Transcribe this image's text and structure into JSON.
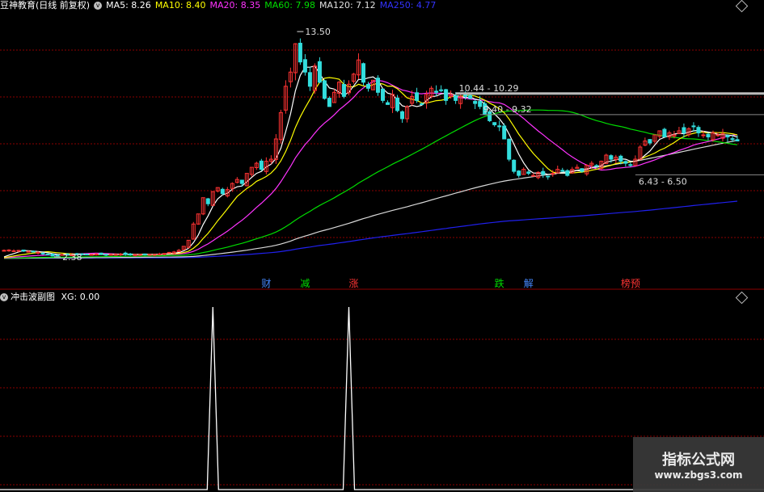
{
  "header": {
    "title": "豆神教育(日线 前复权)",
    "ma_labels": [
      {
        "text": "MA5: 8.26",
        "color": "#ffffff"
      },
      {
        "text": "MA10: 8.40",
        "color": "#ffff00"
      },
      {
        "text": "MA20: 8.35",
        "color": "#ff33ff"
      },
      {
        "text": "MA60: 7.98",
        "color": "#00dd00"
      },
      {
        "text": "MA120: 7.12",
        "color": "#e0e0e0"
      },
      {
        "text": "MA250: 4.77",
        "color": "#3333ff"
      }
    ]
  },
  "sub_header": {
    "title": "冲击波副图",
    "value": "XG: 0.00"
  },
  "watermark": {
    "line1": "指标公式网",
    "line2": "www.zbgs3.com"
  },
  "colors": {
    "up": "#ff3333",
    "down": "#33dddd",
    "grid": "#8b0000",
    "ma5": "#ffffff",
    "ma10": "#ffff00",
    "ma20": "#ff33ff",
    "ma60": "#00dd00",
    "ma120": "#d8d8d8",
    "ma250": "#2020ee"
  },
  "chart_data": {
    "type": "candlestick",
    "price_range": [
      1.5,
      14.5
    ],
    "high_low_marks": [
      {
        "text": "13.50",
        "price": 13.5,
        "bar": 60
      },
      {
        "text": "2.38",
        "price": 2.38,
        "bar": 10
      }
    ],
    "range_labels": [
      {
        "text": "10.44 - 10.29",
        "price": 10.44,
        "from_bar": 93
      },
      {
        "text": "9.40 - 9.32",
        "price": 9.4,
        "from_bar": 98
      },
      {
        "text": "6.43 - 6.50",
        "price": 6.43,
        "from_bar": 130
      }
    ],
    "event_tags": [
      {
        "text": "财",
        "bar": 54,
        "color": "#4488ff"
      },
      {
        "text": "减",
        "bar": 62,
        "color": "#00dd00"
      },
      {
        "text": "涨",
        "bar": 72,
        "color": "#ff3333"
      },
      {
        "text": "跌",
        "bar": 102,
        "color": "#00dd00"
      },
      {
        "text": "解",
        "bar": 108,
        "color": "#4488ff"
      },
      {
        "text": "榜预",
        "bar": 129,
        "color": "#ff3333"
      }
    ],
    "closes": [
      2.7,
      2.72,
      2.68,
      2.7,
      2.66,
      2.65,
      2.62,
      2.6,
      2.55,
      2.5,
      2.42,
      2.45,
      2.5,
      2.48,
      2.5,
      2.52,
      2.5,
      2.48,
      2.5,
      2.52,
      2.5,
      2.48,
      2.5,
      2.5,
      2.52,
      2.5,
      2.48,
      2.5,
      2.5,
      2.52,
      2.5,
      2.5,
      2.52,
      2.55,
      2.6,
      2.62,
      2.7,
      2.9,
      3.2,
      4.0,
      4.5,
      5.3,
      5.0,
      5.6,
      5.8,
      5.5,
      5.7,
      6.0,
      6.2,
      6.0,
      6.5,
      6.8,
      7.0,
      6.7,
      7.1,
      7.2,
      8.2,
      9.5,
      10.8,
      11.5,
      12.9,
      12.0,
      11.5,
      10.8,
      11.8,
      11.0,
      10.2,
      9.8,
      10.5,
      11.0,
      10.3,
      10.9,
      11.4,
      12.1,
      11.0,
      10.7,
      11.1,
      10.5,
      10.1,
      9.9,
      10.4,
      9.6,
      9.2,
      9.8,
      10.3,
      10.1,
      9.9,
      10.4,
      10.7,
      10.5,
      10.6,
      10.1,
      10.4,
      10.1,
      10.3,
      10.3,
      10.2,
      9.95,
      9.8,
      9.4,
      9.1,
      8.9,
      8.8,
      8.2,
      7.2,
      6.6,
      6.4,
      6.7,
      6.5,
      6.4,
      6.55,
      6.45,
      6.35,
      6.5,
      6.7,
      6.6,
      6.4,
      6.7,
      6.8,
      6.6,
      6.9,
      7.0,
      6.85,
      7.1,
      7.4,
      7.2,
      7.3,
      7.1,
      7.0,
      6.9,
      7.2,
      7.8,
      8.1,
      8.0,
      8.4,
      8.6,
      8.3,
      8.5,
      8.4,
      8.6,
      8.5,
      8.7,
      8.8,
      8.5,
      8.4,
      8.3,
      8.5,
      8.4,
      8.45,
      8.3,
      8.2,
      8.1
    ],
    "oscillator": {
      "name": "XG",
      "range": [
        0,
        1
      ],
      "spikes_at_bars": [
        43,
        71
      ],
      "baseline": 0
    }
  }
}
